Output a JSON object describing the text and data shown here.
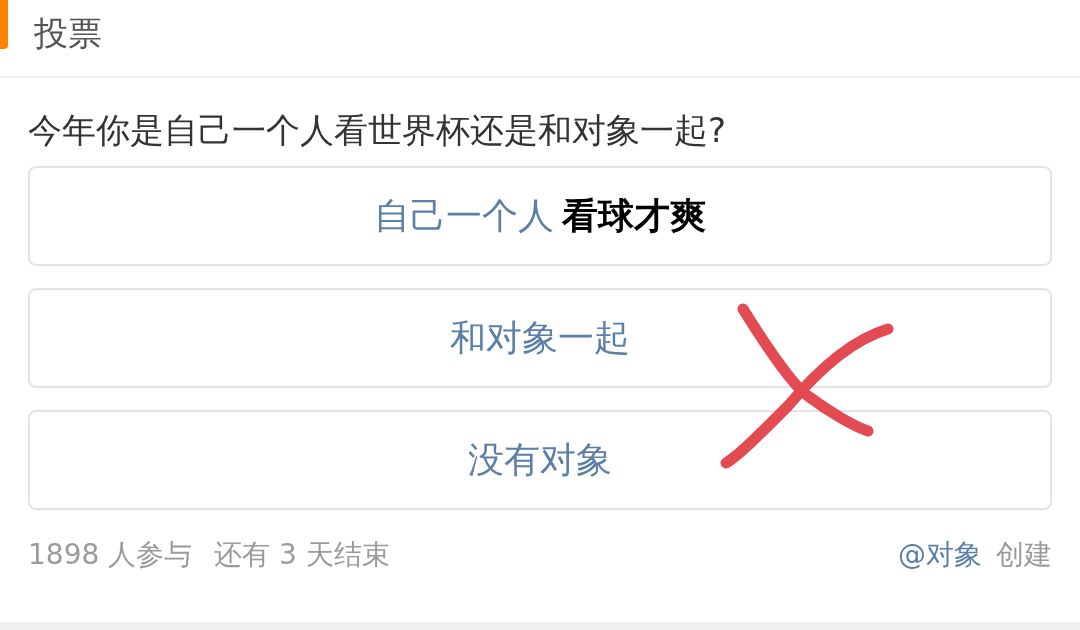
{
  "header": {
    "title": "投票"
  },
  "question": "今年你是自己一个人看世界杯还是和对象一起?",
  "options": [
    {
      "label": "自己一个人",
      "added_text": "看球才爽"
    },
    {
      "label": "和对象一起"
    },
    {
      "label": "没有对象"
    }
  ],
  "markups": [
    {
      "kind": "cross"
    }
  ],
  "footer": {
    "participants": "1898 人参与",
    "remaining": "还有 3 天结束",
    "creator": "@对象",
    "created": "创建"
  }
}
